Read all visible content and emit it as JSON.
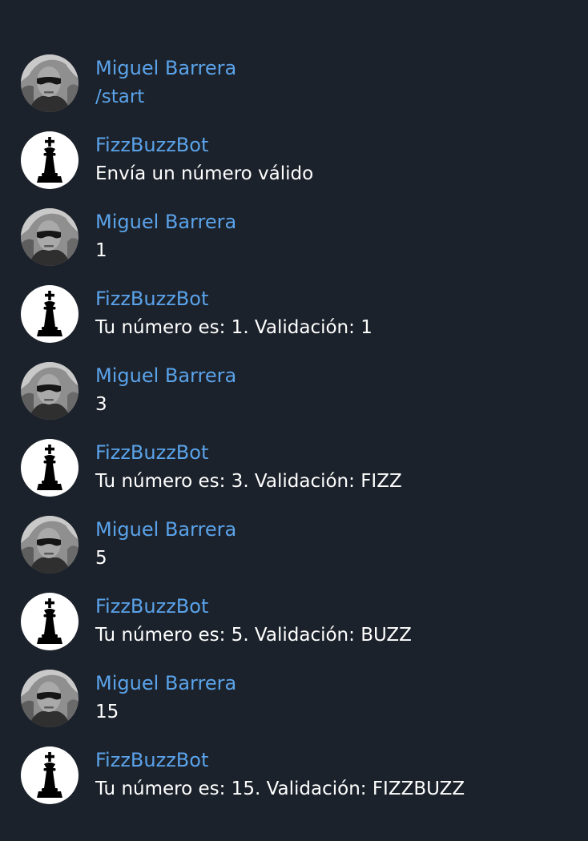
{
  "theme": {
    "background": "#1c222b",
    "sender_color": "#5aa3ea",
    "text_color": "#ffffff",
    "command_color": "#5aa3ea"
  },
  "users": {
    "human": {
      "name": "Miguel Barrera",
      "avatar_icon": "user-photo-icon"
    },
    "bot": {
      "name": "FizzBuzzBot",
      "avatar_icon": "chess-king-icon"
    }
  },
  "messages": [
    {
      "sender": "Miguel Barrera",
      "role": "human",
      "text": "/start",
      "is_command": true
    },
    {
      "sender": "FizzBuzzBot",
      "role": "bot",
      "text": "Envía un número válido",
      "is_command": false
    },
    {
      "sender": "Miguel Barrera",
      "role": "human",
      "text": "1",
      "is_command": false
    },
    {
      "sender": "FizzBuzzBot",
      "role": "bot",
      "text": "Tu número es: 1. Validación: 1",
      "is_command": false
    },
    {
      "sender": "Miguel Barrera",
      "role": "human",
      "text": "3",
      "is_command": false
    },
    {
      "sender": "FizzBuzzBot",
      "role": "bot",
      "text": "Tu número es: 3. Validación: FIZZ",
      "is_command": false
    },
    {
      "sender": "Miguel Barrera",
      "role": "human",
      "text": "5",
      "is_command": false
    },
    {
      "sender": "FizzBuzzBot",
      "role": "bot",
      "text": "Tu número es: 5. Validación: BUZZ",
      "is_command": false
    },
    {
      "sender": "Miguel Barrera",
      "role": "human",
      "text": "15",
      "is_command": false
    },
    {
      "sender": "FizzBuzzBot",
      "role": "bot",
      "text": "Tu número es: 15. Validación: FIZZBUZZ",
      "is_command": false
    }
  ]
}
